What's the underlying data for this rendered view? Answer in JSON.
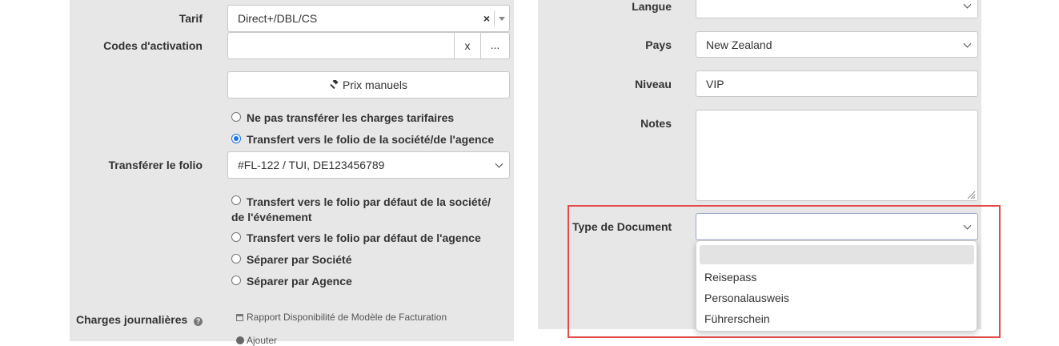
{
  "left": {
    "tarif": {
      "label": "Tarif",
      "value": "Direct+/DBL/CS",
      "clear": "×"
    },
    "codes": {
      "label": "Codes d'activation",
      "value": "",
      "clear_button": "x",
      "more_button": "..."
    },
    "prix_manuels": {
      "label": "Prix manuels"
    },
    "radios_top": [
      {
        "label": "Ne pas transférer les charges tarifaires",
        "checked": false
      },
      {
        "label": "Transfert vers le folio de la société/de l'agence",
        "checked": true
      }
    ],
    "transferer": {
      "label": "Transférer le folio",
      "value": "#FL-122 / TUI, DE123456789"
    },
    "radios_bottom": [
      {
        "label_line1": "Transfert vers le folio par défaut de la société/",
        "label_line2": "de l'événement",
        "checked": false
      },
      {
        "label": "Transfert vers le folio par défaut de l'agence",
        "checked": false
      },
      {
        "label": "Séparer par Société",
        "checked": false
      },
      {
        "label": "Séparer par Agence",
        "checked": false
      }
    ],
    "charges": {
      "label": "Charges journalières",
      "help_icon": "?",
      "link": "Rapport Disponibilité de Modèle de Facturation",
      "add": "Ajouter"
    }
  },
  "right": {
    "langue": {
      "label": "Langue",
      "value": ""
    },
    "pays": {
      "label": "Pays",
      "value": "New Zealand"
    },
    "niveau": {
      "label": "Niveau",
      "value": "VIP"
    },
    "notes": {
      "label": "Notes",
      "value": ""
    },
    "type_document": {
      "label": "Type de Document",
      "value": "",
      "options": [
        "",
        "Reisepass",
        "Personalausweis",
        "Führerschein"
      ]
    }
  },
  "colors": {
    "panel": "#e7e7e7",
    "highlight": "#e34b4b",
    "radio_checked": "#1a73e8"
  }
}
